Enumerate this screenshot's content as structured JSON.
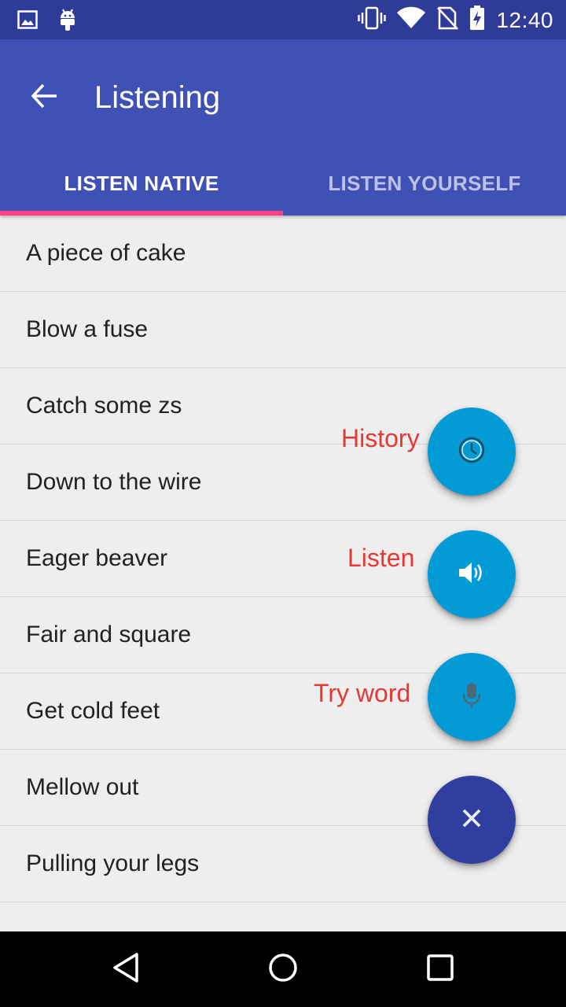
{
  "status_bar": {
    "time": "12:40",
    "icons": [
      "image-icon",
      "android-icon",
      "vibrate-icon",
      "wifi-icon",
      "no-sim-icon",
      "battery-charging-icon"
    ]
  },
  "app_bar": {
    "title": "Listening",
    "back_icon": "arrow-back-icon"
  },
  "tabs": [
    {
      "label": "LISTEN NATIVE",
      "selected": true
    },
    {
      "label": "LISTEN YOURSELF",
      "selected": false
    }
  ],
  "list": {
    "items": [
      "A piece of cake",
      "Blow a fuse",
      "Catch some zs",
      "Down to the wire",
      "Eager beaver",
      "Fair and square",
      "Get cold feet",
      "Mellow out",
      "Pulling your legs"
    ]
  },
  "fab_menu": {
    "history_label": "History",
    "listen_label": "Listen",
    "try_word_label": "Try word",
    "colors": {
      "mini": "#039BD5",
      "main": "#303F9F",
      "label": "#E53935"
    }
  },
  "colors": {
    "primary": "#3F51B5",
    "primary_dark": "#2E3C97",
    "accent": "#FF4081"
  }
}
